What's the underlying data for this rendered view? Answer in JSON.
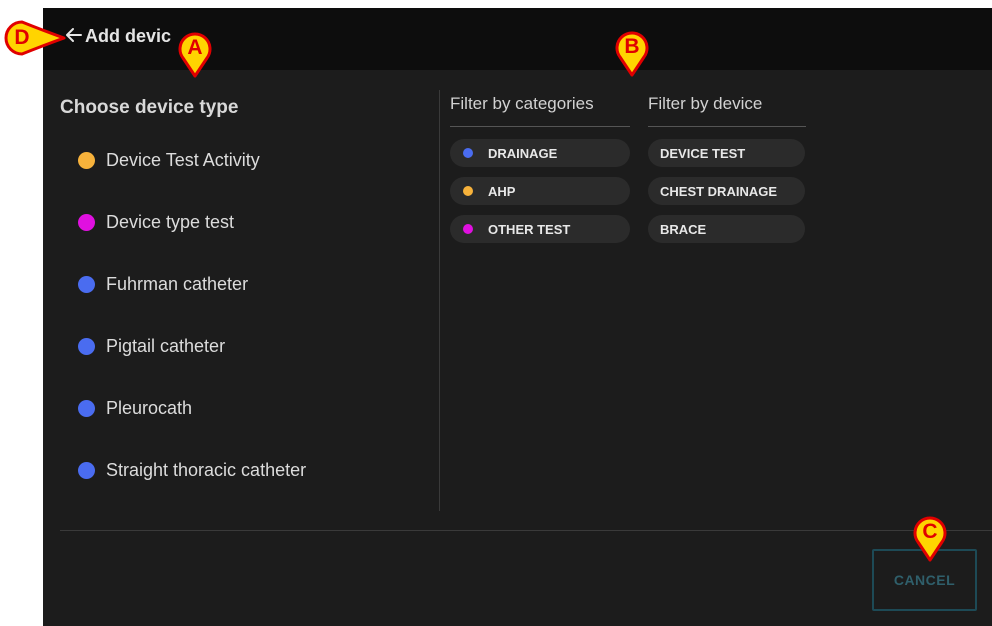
{
  "header": {
    "title": "Add devic"
  },
  "device_types": {
    "heading": "Choose device type",
    "items": [
      {
        "label": "Device Test Activity",
        "color": "#f7b23b"
      },
      {
        "label": "Device type test",
        "color": "#e010e0"
      },
      {
        "label": "Fuhrman catheter",
        "color": "#4a6cf0"
      },
      {
        "label": "Pigtail catheter",
        "color": "#4a6cf0"
      },
      {
        "label": "Pleurocath",
        "color": "#4a6cf0"
      },
      {
        "label": "Straight thoracic catheter",
        "color": "#4a6cf0"
      }
    ]
  },
  "filters": {
    "categories_label": "Filter by categories",
    "device_label": "Filter by device",
    "categories": [
      {
        "label": "DRAINAGE",
        "color": "#4a6cf0"
      },
      {
        "label": "AHP",
        "color": "#f7b23b"
      },
      {
        "label": "OTHER TEST",
        "color": "#e010e0"
      }
    ],
    "devices": [
      {
        "label": "DEVICE TEST"
      },
      {
        "label": "CHEST DRAINAGE"
      },
      {
        "label": "BRACE"
      }
    ]
  },
  "footer": {
    "cancel_label": "CANCEL"
  },
  "callouts": {
    "a": "A",
    "b": "B",
    "c": "C",
    "d": "D",
    "fill_color": "#ffd400",
    "text_color": "#e00000"
  }
}
